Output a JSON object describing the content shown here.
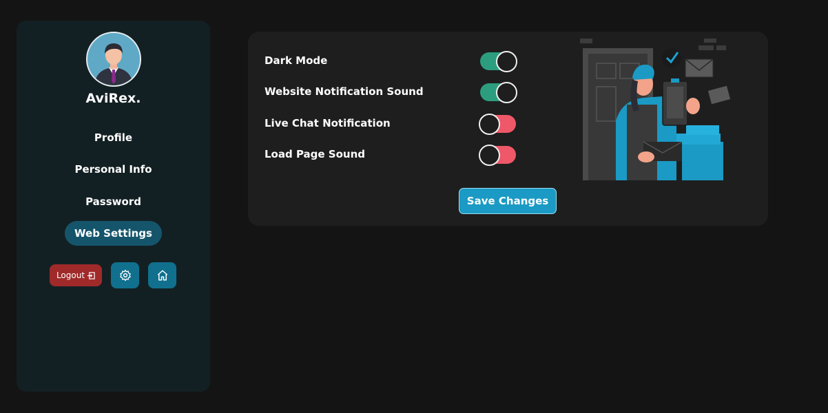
{
  "sidebar": {
    "username": "AviRex.",
    "nav": [
      {
        "label": "Profile"
      },
      {
        "label": "Personal Info"
      },
      {
        "label": "Password"
      },
      {
        "label": "Web Settings",
        "active": true
      }
    ],
    "logout_label": "Logout",
    "logout_icon": "logout-icon",
    "settings_icon": "gear-icon",
    "home_icon": "home-icon"
  },
  "settings": [
    {
      "label": "Dark Mode",
      "enabled": true
    },
    {
      "label": "Website Notification Sound",
      "enabled": true
    },
    {
      "label": "Live Chat Notification",
      "enabled": false
    },
    {
      "label": "Load Page Sound",
      "enabled": false
    }
  ],
  "save_label": "Save Changes",
  "colors": {
    "toggle_on": "#2c9e7f",
    "toggle_off": "#ee5868",
    "accent": "#1a9ac4",
    "logout": "#a02a2a",
    "active_nav": "#15556b"
  }
}
